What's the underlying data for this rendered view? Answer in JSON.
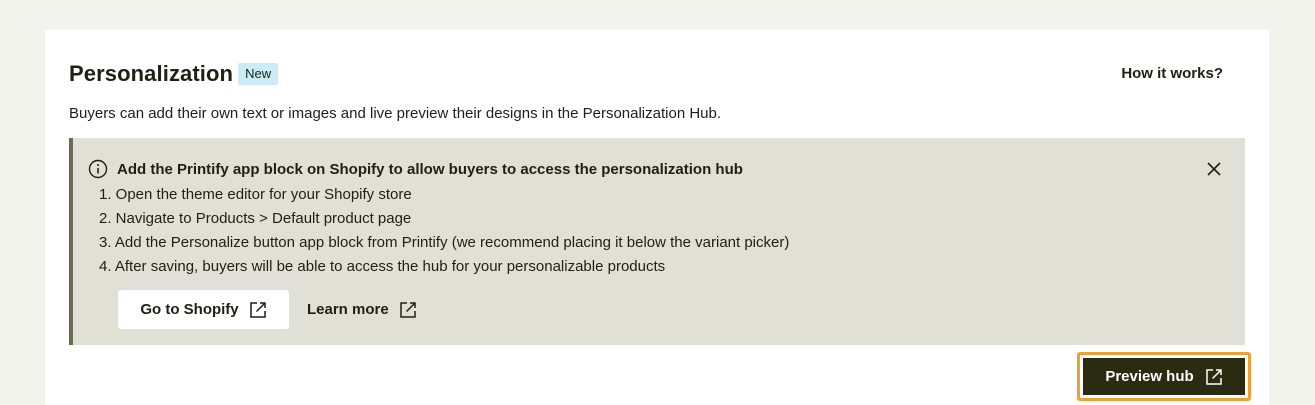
{
  "header": {
    "title": "Personalization",
    "badge": "New",
    "how_it_works": "How it works?"
  },
  "description": "Buyers can add their own text or images and live preview their designs in the Personalization Hub.",
  "notice": {
    "icon": "info-icon",
    "heading": "Add the Printify app block on Shopify to allow buyers to access the personalization hub",
    "steps": [
      "1. Open the theme editor for your Shopify store",
      "2. Navigate to Products > Default product page",
      "3. Add the Personalize button app block from Printify (we recommend placing it below the variant picker)",
      "4. After saving, buyers will be able to access the hub for your personalizable products"
    ],
    "go_to_shopify": "Go to Shopify",
    "learn_more": "Learn more",
    "close_icon": "close-icon"
  },
  "preview_hub": "Preview hub",
  "colors": {
    "page_bg": "#f3f3ee",
    "card_bg": "#ffffff",
    "badge_bg": "#c9ecf6",
    "notice_bg": "#e1e0d6",
    "notice_border": "#6d6a55",
    "primary_button": "#2b2b12",
    "focus_ring": "#f29e37",
    "text": "#1f1f14"
  }
}
